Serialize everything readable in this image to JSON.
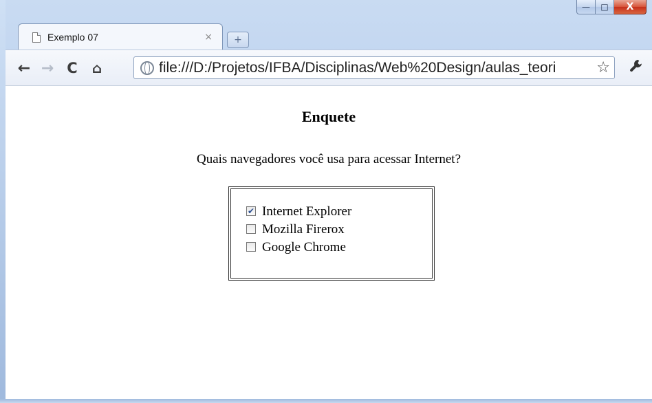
{
  "window": {
    "controls": {
      "minimize": "—",
      "maximize": "□",
      "close": "X"
    }
  },
  "tab": {
    "title": "Exemplo 07",
    "close": "×",
    "new_tab": "+"
  },
  "toolbar": {
    "back": "←",
    "forward": "→",
    "reload": "C",
    "home": "⌂",
    "url": "file:///D:/Projetos/IFBA/Disciplinas/Web%20Design/aulas_teori",
    "bookmark": "☆",
    "wrench": "🔧"
  },
  "page": {
    "title": "Enquete",
    "question": "Quais navegadores você usa para acessar Internet?",
    "options": [
      {
        "label": "Internet Explorer",
        "checked": true
      },
      {
        "label": "Mozilla Firerox",
        "checked": false
      },
      {
        "label": "Google Chrome",
        "checked": false
      }
    ]
  }
}
